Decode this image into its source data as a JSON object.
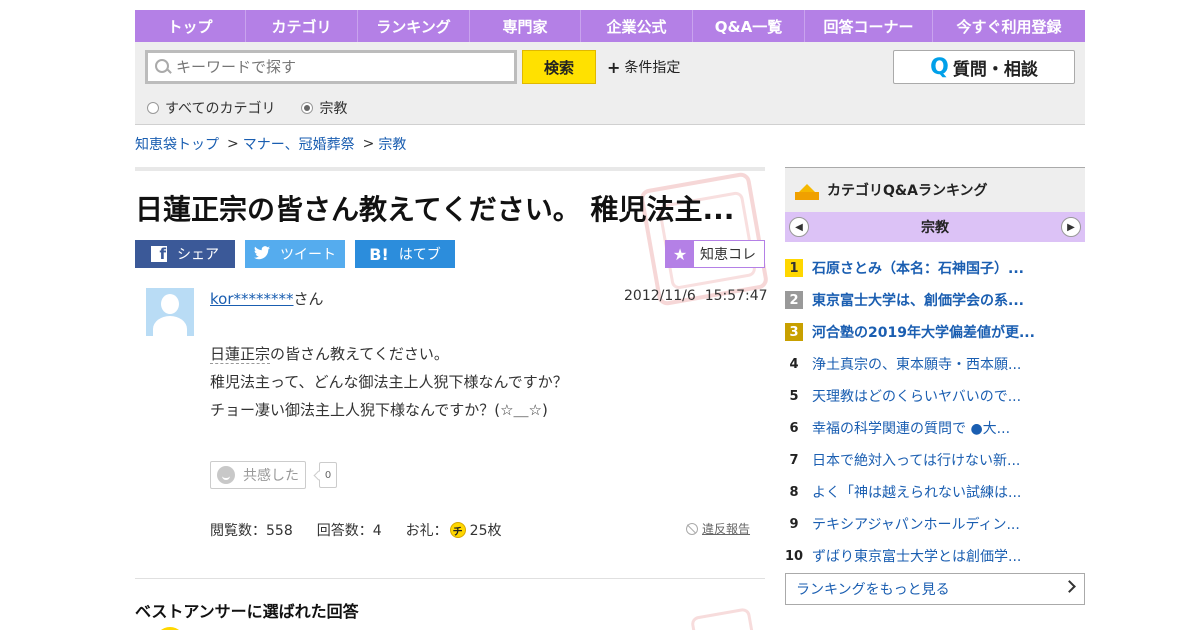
{
  "nav": {
    "items": [
      {
        "label": "トップ"
      },
      {
        "label": "カテゴリ"
      },
      {
        "label": "ランキング"
      },
      {
        "label": "専門家"
      },
      {
        "label": "企業公式"
      },
      {
        "label": "Q&A一覧"
      },
      {
        "label": "回答コーナー"
      },
      {
        "label": "今すぐ利用登録"
      }
    ]
  },
  "search": {
    "placeholder": "キーワードで探す",
    "button": "検索",
    "conditions": "条件指定",
    "radio_all": "すべてのカテゴリ",
    "radio_current": "宗教",
    "ask_q": "Q",
    "ask_label": "質問・相談"
  },
  "breadcrumb": {
    "items": [
      "知恵袋トップ",
      "マナー、冠婚葬祭",
      "宗教"
    ],
    "sep": ">"
  },
  "question": {
    "title": "日蓮正宗の皆さん教えてください。 稚児法主...",
    "share_fb": "シェア",
    "share_tw": "ツイート",
    "share_hb": "はてブ",
    "chiecolle": "知恵コレ",
    "user": "kor********",
    "user_suffix": "さん",
    "date": "2012/11/6",
    "time": "15:57:47",
    "body_kw": "日蓮正宗",
    "body_line1_rest": "の皆さん教えてください。",
    "body_line2": "稚児法主って、どんな御法主上人猊下様なんですか？",
    "body_line3": "チョー凄い御法主上人猊下様なんですか？(☆＿☆)",
    "kyokan": "共感した",
    "kyokan_count": "0",
    "views": "閲覧数：558",
    "answers": "回答数：4",
    "reward_label": "お礼：",
    "coin": "チ",
    "reward_value": "25枚",
    "report": "違反報告",
    "best_heading": "ベストアンサーに選ばれた回答"
  },
  "sidebar": {
    "heading": "カテゴリQ&Aランキング",
    "category": "宗教",
    "ranking": [
      {
        "num": "1",
        "title": "石原さとみ（本名：石神国子）..."
      },
      {
        "num": "2",
        "title": "東京富士大学は、創価学会の系..."
      },
      {
        "num": "3",
        "title": "河合塾の2019年大学偏差値が更..."
      },
      {
        "num": "4",
        "title": "浄土真宗の、東本願寺・西本願..."
      },
      {
        "num": "5",
        "title": "天理教はどのくらいヤバいので..."
      },
      {
        "num": "6",
        "title": "幸福の科学関連の質問で ●大..."
      },
      {
        "num": "7",
        "title": "日本で絶対入っては行けない新..."
      },
      {
        "num": "8",
        "title": "よく「神は越えられない試練は..."
      },
      {
        "num": "9",
        "title": "テキシアジャパンホールディン..."
      },
      {
        "num": "10",
        "title": "ずばり東京富士大学とは創価学..."
      }
    ],
    "more": "ランキングをもっと見る"
  }
}
